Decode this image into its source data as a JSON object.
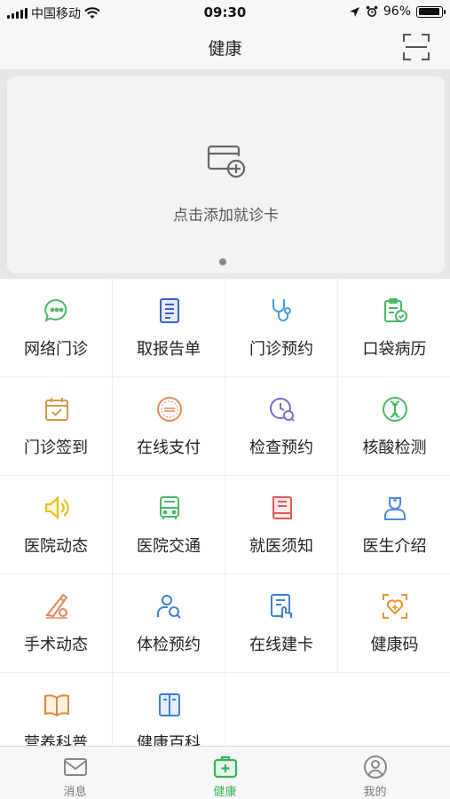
{
  "status_bar": {
    "carrier": "中国移动",
    "time": "09:30",
    "battery": "96%",
    "battery_level": 0.96
  },
  "header": {
    "title": "健康",
    "scan_icon": "scan-icon"
  },
  "card": {
    "add_label": "点击添加就诊卡",
    "add_icon": "add-card-icon"
  },
  "grid": {
    "items": [
      {
        "label": "网络门诊",
        "icon": "chat-bubble-icon",
        "color": "#4bb866"
      },
      {
        "label": "取报告单",
        "icon": "report-document-icon",
        "color": "#3f5fc8"
      },
      {
        "label": "门诊预约",
        "icon": "stethoscope-icon",
        "color": "#4a9be0"
      },
      {
        "label": "口袋病历",
        "icon": "clipboard-check-icon",
        "color": "#4bb866"
      },
      {
        "label": "门诊签到",
        "icon": "calendar-check-icon",
        "color": "#d09a4a"
      },
      {
        "label": "在线支付",
        "icon": "pay-stamp-icon",
        "color": "#e08a5a"
      },
      {
        "label": "检查预约",
        "icon": "clock-search-icon",
        "color": "#7b6ac8"
      },
      {
        "label": "核酸检测",
        "icon": "dna-icon",
        "color": "#4bb866"
      },
      {
        "label": "医院动态",
        "icon": "speaker-icon",
        "color": "#e6c21e"
      },
      {
        "label": "医院交通",
        "icon": "bus-icon",
        "color": "#4bb866"
      },
      {
        "label": "就医须知",
        "icon": "notice-book-icon",
        "color": "#e05a5a"
      },
      {
        "label": "医生介绍",
        "icon": "doctor-icon",
        "color": "#4a8be0"
      },
      {
        "label": "手术动态",
        "icon": "scalpel-icon",
        "color": "#e08a5a"
      },
      {
        "label": "体检预约",
        "icon": "person-search-icon",
        "color": "#3f7fd0"
      },
      {
        "label": "在线建卡",
        "icon": "card-touch-icon",
        "color": "#3f7fd0"
      },
      {
        "label": "健康码",
        "icon": "heart-scan-icon",
        "color": "#e8922e"
      },
      {
        "label": "营养科普",
        "icon": "open-book-icon",
        "color": "#d0913a"
      },
      {
        "label": "健康百科",
        "icon": "encyclopedia-icon",
        "color": "#3f7fd0"
      }
    ]
  },
  "tabbar": {
    "tabs": [
      {
        "label": "消息",
        "icon": "message-envelope-icon",
        "active": false
      },
      {
        "label": "健康",
        "icon": "medical-kit-icon",
        "active": true
      },
      {
        "label": "我的",
        "icon": "user-profile-icon",
        "active": false
      }
    ],
    "active_color": "#35b35b",
    "inactive_color": "#888888"
  }
}
